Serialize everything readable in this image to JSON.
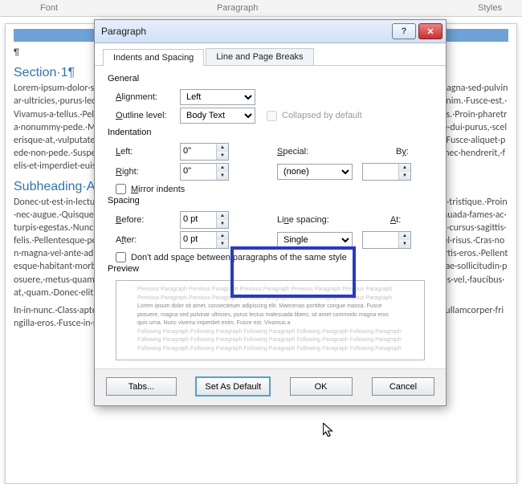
{
  "ribbon": {
    "group1": "Font",
    "group2": "Paragraph",
    "group3": "Styles"
  },
  "doc": {
    "pilcrow": "¶",
    "heading1": "Section·1¶",
    "para1": "Lorem·ipsum·dolor·sit·amet,·consectetuer·adipiscing·elit.·Maecenas·porttitor·congue·massa.·Fusce·posuere,·magna·sed·pulvinar·ultricies,·purus·lectus·malesuada·libero,·sit·amet·commodo·magna·eros·quis·urna.·Nunc·viverra·imperdiet·enim.·Fusce·est.·Vivamus·a·tellus.·Pellentesque·habitant·morbi·tristique·senectus·et·netus·et·malesuada·fames·ac·turpis·egestas.·Proin·pharetra·nonummy·pede.·Mauris·et·orci.·Aenean·nec·lorem.·In·porttitor.·Donec·laoreet·nonummy·augue.·Suspendisse·dui·purus,·scelerisque·at,·vulputate·vitae,·pretium·mattis,·nunc.·Mauris·eget·neque·at·sem·venenatis·eleifend.·Ut·nonummy.·Fusce·aliquet·pede·non·pede.·Suspendisse·dapibus·lorem·pellentesque·magna.·Integer·nulla.·Donec·blandit·feugiat·ligula.·Donec·hendrerit,·felis·et·imperdiet·euismod,·purus·ipsum·pretium·metus,·in·lacinia·nulla·nisl·eget·sapien.¶",
    "heading2": "Subheading·A¶",
    "para2": "Donec·ut·est·in·lectus·consequat·consequat.·Etiam·eget·dui.·Aliquam·erat·volutpat.·Sed·at·lorem·in·nunc·porta·tristique.·Proin·nec·augue.·Quisque·aliquam·tempor·magna.·Pellentesque·habitant·morbi·tristique·senectus·et·netus·et·malesuada·fames·ac·turpis·egestas.·Nunc·ac·magna.·Maecenas·odio·dolor,·vulputate·vel,·auctor·ac,·accumsan·id,·felis.·Pellentesque·cursus·sagittis·felis.·Pellentesque·porttitor,·velit·lacinia·egestas·auctor,·diam·eros·tempus·arcu,·nec·vulputate·augue·magna·vel·risus.·Cras·non·magna·vel·ante·adipiscing·rhoncus.·Vivamus·a·mi.·Morbi·neque.·Aliquam·erat·volutpat.·Integer·ultrices·lobortis·eros.·Pellentesque·habitant·morbi·tristique·senectus·et·netus·et·malesuada·fames·ac·turpis·egestas.·Proin·semper,·ante·vitae·sollicitudin·posuere,·metus·quam·iaculis·nibh,·vitae·scelerisque·nunc·massa·eget·pede.·Sed·velit·urna,·interdum·vel,·ultricies·vel,·faucibus·at,·quam.·Donec·elit·est,·consectetuer·eget,·consequat·quis,·tempus·quis,·wisi.¶",
    "para3": "In·in·nunc.·Class·aptent·taciti·sociosqu·ad·litora·torquent·per·conubia·nostra,·per·inceptos·hymenaeos.·Donec·ullamcorper·fringilla·eros.·Fusce·in·sapien·eu·purus·dapibus·commodo.·Cum·sociis·natoque·"
  },
  "dialog": {
    "title": "Paragraph",
    "tab1": "Indents and Spacing",
    "tab2": "Line and Page Breaks",
    "general": {
      "label": "General",
      "alignment_label": "Alignment:",
      "alignment_value": "Left",
      "outline_label": "Outline level:",
      "outline_value": "Body Text",
      "collapsed_label": "Collapsed by default"
    },
    "indentation": {
      "label": "Indentation",
      "left_label": "Left:",
      "left_value": "0\"",
      "right_label": "Right:",
      "right_value": "0\"",
      "special_label": "Special:",
      "special_value": "(none)",
      "by_label": "By:",
      "by_value": "",
      "mirror_label": "Mirror indents"
    },
    "spacing": {
      "label": "Spacing",
      "before_label": "Before:",
      "before_value": "0 pt",
      "after_label": "After:",
      "after_value": "0 pt",
      "linesp_label": "Line spacing:",
      "linesp_value": "Single",
      "at_label": "At:",
      "at_value": "",
      "dontadd_label": "Don't add space between paragraphs of the same style"
    },
    "preview": {
      "label": "Preview",
      "faint": "Previous Paragraph Previous Paragraph Previous Paragraph Previous Paragraph Previous Paragraph",
      "dark1": "Lorem ipsum dolor sit amet, consectetuer adipiscing elit. Maecenas porttitor congue massa. Fusce",
      "dark2": "posuere, magna sed pulvinar ultricies, purus lectus malesuada libero, sit amet commodo magna eros",
      "dark3": "quis urna. Nunc viverra imperdiet enim. Fusce est. Vivamus a",
      "follow": "Following Paragraph Following Paragraph Following Paragraph Following Paragraph Following Paragraph"
    },
    "buttons": {
      "tabs": "Tabs...",
      "default": "Set As Default",
      "ok": "OK",
      "cancel": "Cancel"
    }
  }
}
